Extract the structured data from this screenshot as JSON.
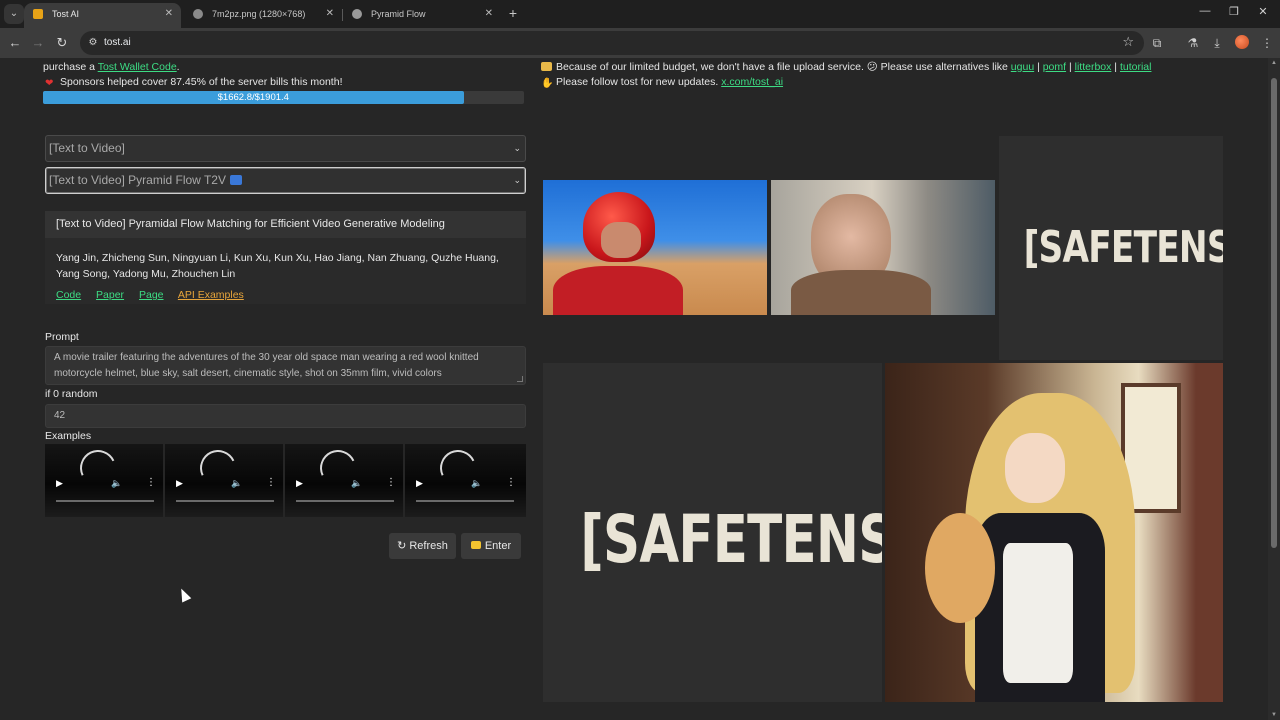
{
  "browser": {
    "tabs": [
      {
        "title": "Tost AI"
      },
      {
        "title": "7m2pz.png (1280×768)"
      },
      {
        "title": "Pyramid Flow"
      }
    ],
    "url": "tost.ai"
  },
  "banner": {
    "purchase_prefix": "purchase a",
    "wallet_link": "Tost Wallet Code",
    "period": ".",
    "sponsors_text": "Sponsors helped cover 87.45% of the server bills this month!",
    "progress_label": "$1662.8/$1901.4",
    "progress_fraction": 0.8745,
    "upload_notice": "Because of our limited budget, we don't have a file upload service. 😕 Please use alternatives like",
    "upload_links": [
      "uguu",
      "pomf",
      "litterbox",
      "tutorial"
    ],
    "follow_text": "Please follow tost for new updates.",
    "follow_link": "x.com/tost_ai"
  },
  "form": {
    "category_select": "[Text to Video]",
    "model_select": "[Text to Video] Pyramid Flow T2V",
    "card": {
      "title": "[Text to Video] Pyramidal Flow Matching for Efficient Video Generative Modeling",
      "authors": "Yang Jin, Zhicheng Sun, Ningyuan Li, Kun Xu, Kun Xu, Hao Jiang, Nan Zhuang, Quzhe Huang, Yang Song, Yadong Mu, Zhouchen Lin",
      "links": [
        "Code",
        "Paper",
        "Page",
        "API Examples"
      ]
    },
    "prompt_label": "Prompt",
    "prompt_value": "A movie trailer featuring the adventures of the 30 year old space man wearing a red wool knitted motorcycle helmet, blue sky, salt desert, cinematic style, shot on 35mm film, vivid colors",
    "seed_label": "if 0 random",
    "seed_value": "42",
    "examples_label": "Examples",
    "refresh_label": "Refresh",
    "enter_label": "Enter"
  },
  "gallery": {
    "stamp_text": "[SAFETENSORS]"
  }
}
